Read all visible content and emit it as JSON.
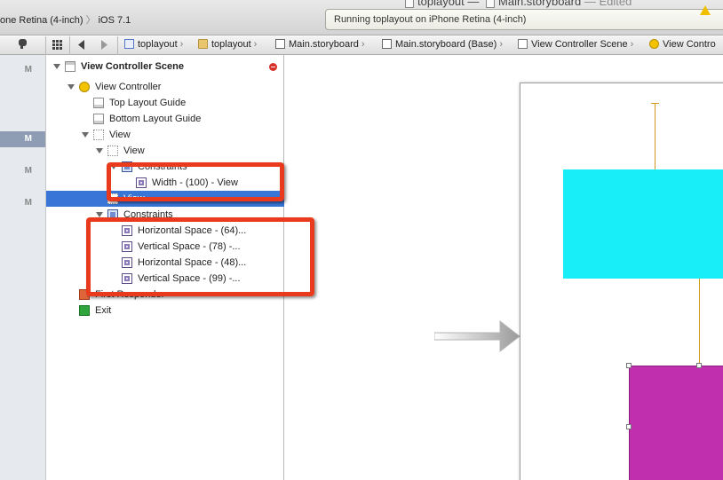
{
  "titlebar": {
    "scheme_device": "one Retina (4-inch)",
    "scheme_os": "iOS 7.1",
    "window_project": "toplayout",
    "window_file": "Main.storyboard",
    "window_state": "Edited",
    "activity_text": "Running toplayout on iPhone Retina (4-inch)"
  },
  "jumpbar": {
    "items": [
      "toplayout",
      "toplayout",
      "Main.storyboard",
      "Main.storyboard (Base)",
      "View Controller Scene",
      "View Contro"
    ]
  },
  "left_strip": {
    "markers": [
      "M",
      "M",
      "M",
      "M"
    ]
  },
  "outline": {
    "rows": [
      "View Controller Scene",
      "View Controller",
      "Top Layout Guide",
      "Bottom Layout Guide",
      "View",
      "View",
      "Constraints",
      "Width - (100) - View",
      "View",
      "Constraints",
      "Horizontal Space - (64)...",
      "Vertical Space - (78) -...",
      "Horizontal Space - (48)...",
      "Vertical Space - (99) -...",
      "First Responder",
      "Exit"
    ]
  },
  "colors": {
    "cyan_view": "#18eef8",
    "magenta_view": "#bf2fae",
    "annotation_red": "#ea3a1d",
    "selection_blue": "#3875d7",
    "constraint_line": "#d49a20"
  }
}
